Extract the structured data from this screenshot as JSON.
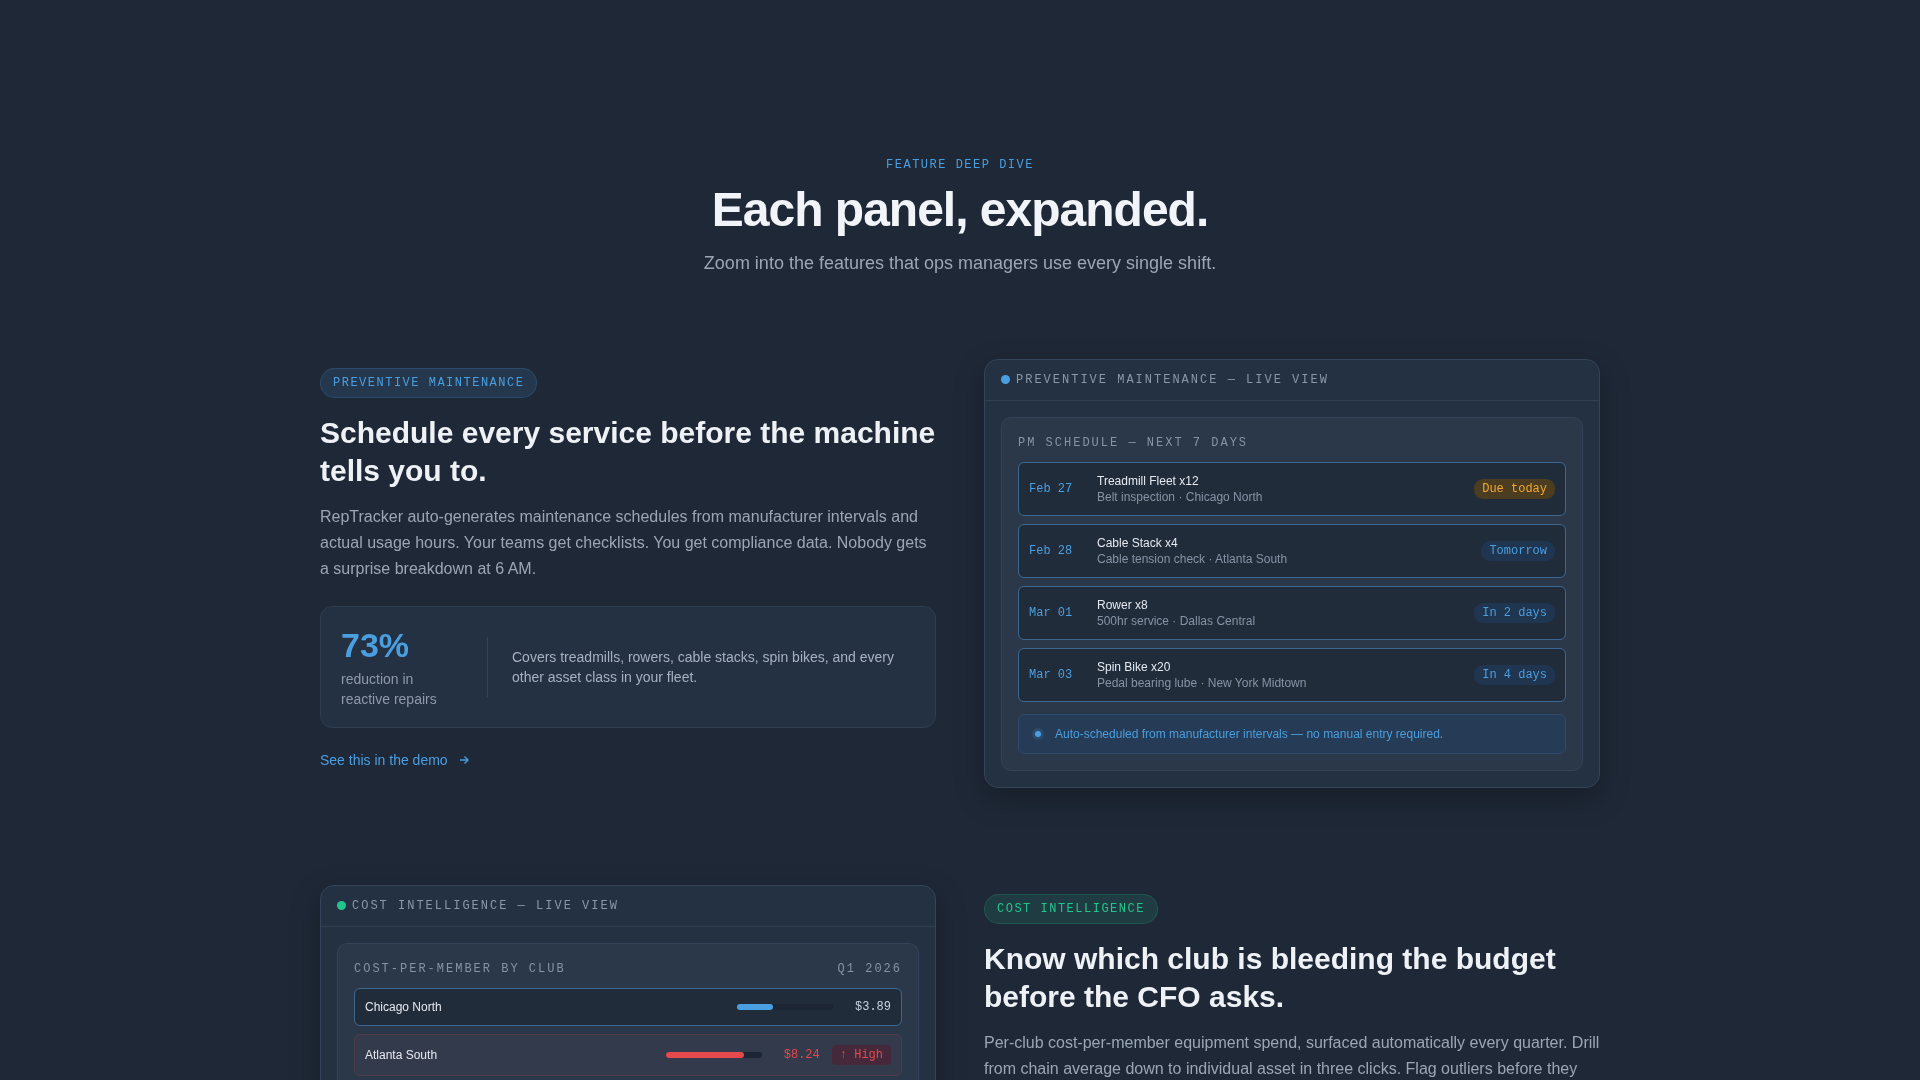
{
  "header": {
    "eyebrow": "FEATURE DEEP DIVE",
    "title": "Each panel, expanded.",
    "subtitle": "Zoom into the features that ops managers use every single shift."
  },
  "features": [
    {
      "color": "#4a9fe0",
      "tag": "PREVENTIVE MAINTENANCE",
      "heading": "Schedule every service before the machine tells you to.",
      "body": "RepTracker auto-generates maintenance schedules from manufacturer intervals and actual usage hours. Your teams get checklists. You get compliance data. Nobody gets a surprise breakdown at 6 AM.",
      "stat": {
        "value": "73%",
        "label": "reduction in reactive repairs",
        "note": "Covers treadmills, rowers, cable stacks, spin bikes, and every other asset class in your fleet."
      },
      "link": "See this in the demo",
      "panel": {
        "kind": "schedule",
        "title": "PREVENTIVE MAINTENANCE — LIVE VIEW",
        "card_title": "PM SCHEDULE — NEXT 7 DAYS",
        "rows": [
          {
            "date": "Feb 27",
            "asset": "Treadmill Fleet x12",
            "detail": "Belt inspection · Chicago North",
            "badge": "Due today",
            "due_today": true
          },
          {
            "date": "Feb 28",
            "asset": "Cable Stack x4",
            "detail": "Cable tension check · Atlanta South",
            "badge": "Tomorrow",
            "due_today": false
          },
          {
            "date": "Mar 01",
            "asset": "Rower x8",
            "detail": "500hr service · Dallas Central",
            "badge": "In 2 days",
            "due_today": false
          },
          {
            "date": "Mar 03",
            "asset": "Spin Bike x20",
            "detail": "Pedal bearing lube · New York Midtown",
            "badge": "In 4 days",
            "due_today": false
          }
        ],
        "note": "Auto-scheduled from manufacturer intervals — no manual entry required."
      }
    },
    {
      "color": "#22c58b",
      "tag": "COST INTELLIGENCE",
      "heading": "Know which club is bleeding the budget before the CFO asks.",
      "body": "Per-club cost-per-member equipment spend, surfaced automatically every quarter. Drill from chain average down to individual asset in three clicks. Flag outliers before they",
      "panel": {
        "kind": "cost",
        "title": "COST INTELLIGENCE — LIVE VIEW",
        "card_title": "COST-PER-MEMBER BY CLUB",
        "period": "Q1 2026",
        "rows": [
          {
            "club": "Chicago North",
            "level": 0.38,
            "value": "$3.89",
            "over_budget": false
          },
          {
            "club": "Atlanta South",
            "level": 0.82,
            "value": "$8.24",
            "over_budget": true,
            "flag": "↑ High"
          }
        ]
      }
    }
  ]
}
